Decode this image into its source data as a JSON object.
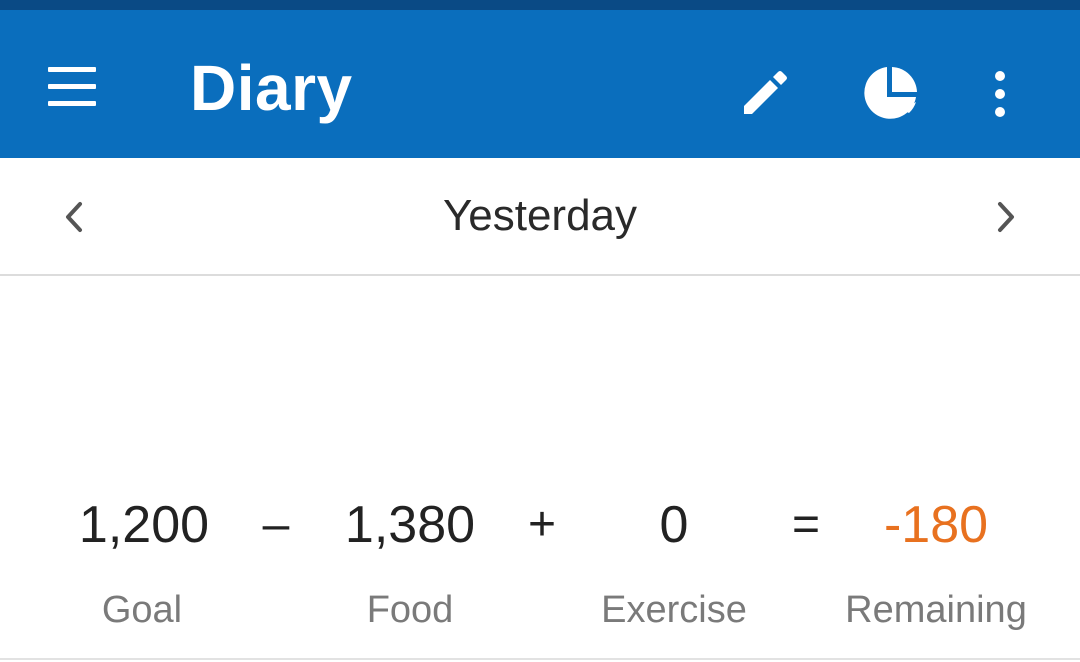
{
  "app_bar": {
    "title": "Diary",
    "accent_color": "#0a6ebd",
    "icons": [
      "menu-icon",
      "pencil-icon",
      "pie-chart-icon",
      "more-vert-icon"
    ]
  },
  "date_nav": {
    "label": "Yesterday",
    "prev_icon": "chevron-left-icon",
    "next_icon": "chevron-right-icon"
  },
  "summary": {
    "goal": {
      "value": "1,200",
      "label": "Goal"
    },
    "minus": "–",
    "food": {
      "value": "1,380",
      "label": "Food"
    },
    "plus": "+",
    "exercise": {
      "value": "0",
      "label": "Exercise"
    },
    "equals": "=",
    "remaining": {
      "value": "-180",
      "label": "Remaining",
      "color": "#e8711f"
    }
  }
}
